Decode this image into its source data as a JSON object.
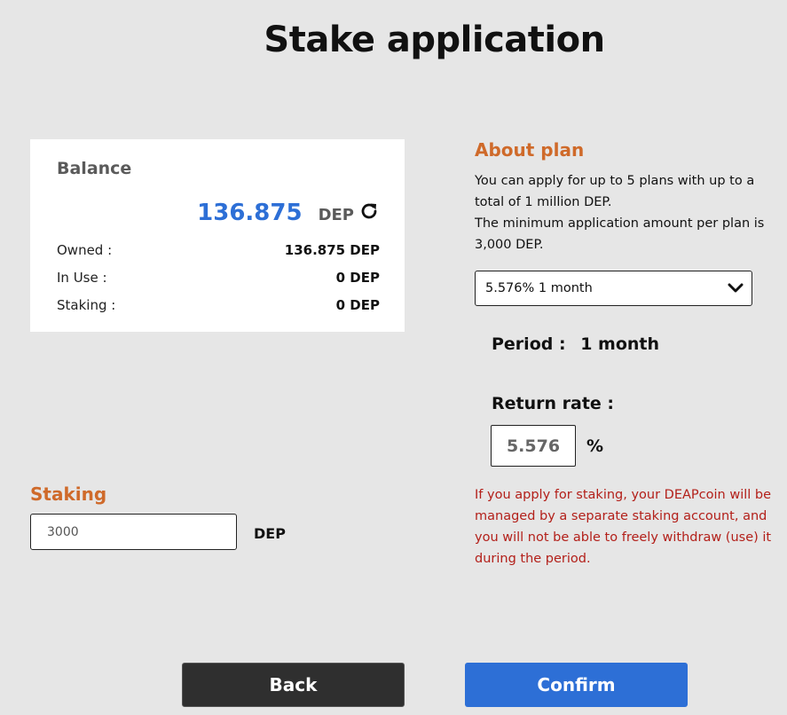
{
  "page": {
    "title": "Stake application"
  },
  "balance": {
    "heading": "Balance",
    "amount": "136.875",
    "unit": "DEP",
    "rows": [
      {
        "label": "Owned :",
        "value": "136.875 DEP"
      },
      {
        "label": "In Use :",
        "value": "0 DEP"
      },
      {
        "label": "Staking :",
        "value": "0 DEP"
      }
    ],
    "refresh_icon": "refresh-icon"
  },
  "about_plan": {
    "heading": "About plan",
    "lines": [
      "You can apply for up to 5 plans with up to a total of 1 million DEP.",
      "The minimum application amount per plan is 3,000 DEP."
    ]
  },
  "plan_select": {
    "selected": "5.576% 1 month",
    "icon": "chevron-down-icon"
  },
  "period": {
    "label": "Period :",
    "value": "1 month"
  },
  "return_rate": {
    "label": "Return rate :",
    "value": "5.576",
    "unit": "%"
  },
  "warning": "If you apply for staking, your DEAPcoin will be managed by a separate staking account, and you will not be able to freely withdraw (use) it during the period.",
  "staking": {
    "heading": "Staking",
    "value": "3000",
    "unit": "DEP"
  },
  "buttons": {
    "back": "Back",
    "confirm": "Confirm"
  },
  "colors": {
    "accent_blue": "#2d6fd6",
    "heading_orange": "#cf6a2a",
    "warning_red": "#b3201a",
    "back_button": "#2f2f2f"
  }
}
